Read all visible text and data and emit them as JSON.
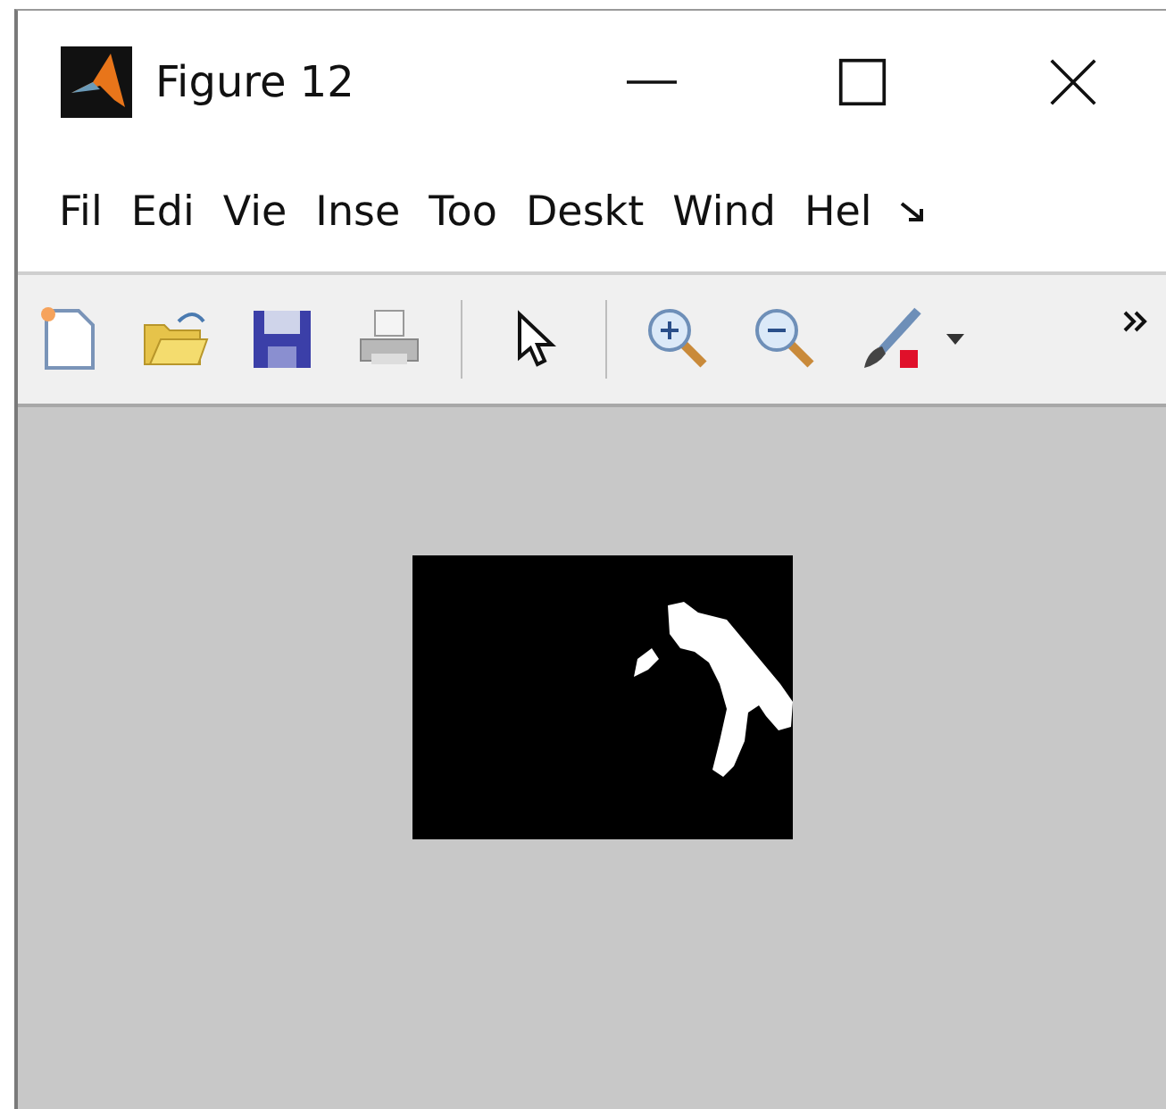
{
  "window": {
    "title": "Figure 12"
  },
  "menu": [
    {
      "label": "Fil"
    },
    {
      "label": "Edi"
    },
    {
      "label": "Vie"
    },
    {
      "label": "Inse"
    },
    {
      "label": "Too"
    },
    {
      "label": "Deskt"
    },
    {
      "label": "Wind"
    },
    {
      "label": "Hel"
    }
  ]
}
